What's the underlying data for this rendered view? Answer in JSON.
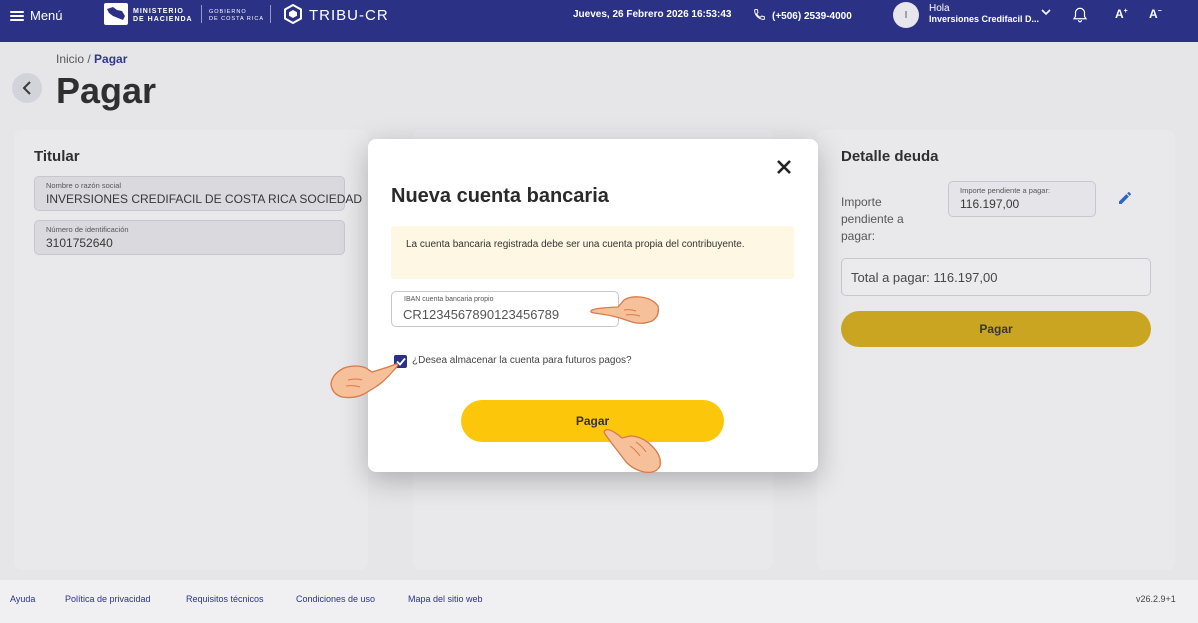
{
  "topbar": {
    "menu_label": "Menú",
    "ministry_line1": "MINISTERIO",
    "ministry_line2": "DE HACIENDA",
    "gov_line1": "GOBIERNO",
    "gov_line2": "DE COSTA RICA",
    "brand": "TRIBU-CR",
    "datetime": "Jueves, 26 Febrero 2026 16:53:43",
    "phone": "(+506) 2539-4000",
    "avatar_initial": "I",
    "greeting": "Hola",
    "user_name": "Inversiones Credifacil D...",
    "font_increase": "A",
    "font_increase_sup": "+",
    "font_decrease": "A",
    "font_decrease_sup": "−",
    "colors": {
      "bar": "#2b3286",
      "accent": "#fcc70a"
    }
  },
  "breadcrumb": {
    "home": "Inicio",
    "separator": "/",
    "current": "Pagar"
  },
  "page_title": "Pagar",
  "titular": {
    "title": "Titular",
    "name_label": "Nombre o razón social",
    "name_value": "INVERSIONES CREDIFACIL DE COSTA RICA SOCIEDAD",
    "id_label": "Número de identificación",
    "id_value": "3101752640"
  },
  "detalle": {
    "title": "Detalle deuda",
    "importe_label": "Importe pendiente a pagar:",
    "importe_field_label": "Importe pendiente a pagar:",
    "importe_value": "116.197,00",
    "total": "Total a pagar: 116.197,00",
    "pay_label": "Pagar"
  },
  "modal": {
    "title": "Nueva cuenta bancaria",
    "notice": "La cuenta bancaria registrada debe ser una cuenta propia del contribuyente.",
    "iban_label": "IBAN cuenta bancaria propio",
    "iban_value": "CR1234567890123456789",
    "checkbox_label": "¿Desea almacenar la cuenta para futuros pagos?",
    "checkbox_checked": true,
    "pay_label": "Pagar"
  },
  "footer": {
    "links": [
      "Ayuda",
      "Política de privacidad",
      "Requisitos técnicos",
      "Condiciones de uso",
      "Mapa del sitio web"
    ],
    "version": "v26.2.9+1"
  }
}
